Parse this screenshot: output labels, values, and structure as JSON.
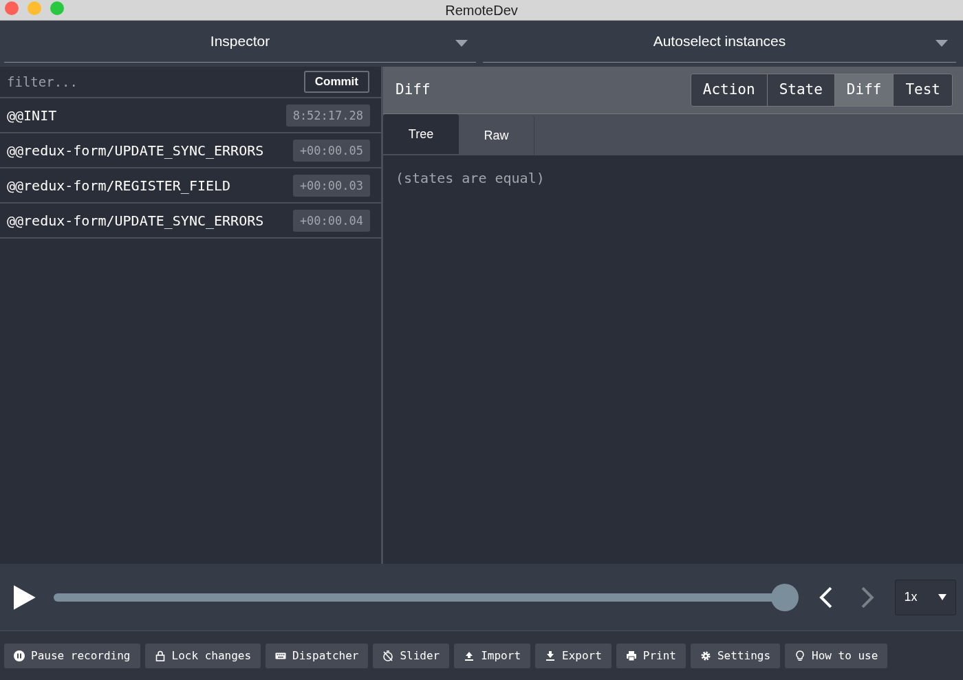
{
  "window": {
    "title": "RemoteDev"
  },
  "header": {
    "monitor": "Inspector",
    "instances": "Autoselect instances"
  },
  "filter": {
    "placeholder": "filter..."
  },
  "commit_button": "Commit",
  "actions": [
    {
      "name": "@@INIT",
      "time": "8:52:17.28",
      "selected": false
    },
    {
      "name": "@@redux-form/UPDATE_SYNC_ERRORS",
      "time": "+00:00.05",
      "selected": false
    },
    {
      "name": "@@redux-form/REGISTER_FIELD",
      "time": "+00:00.03",
      "selected": false
    },
    {
      "name": "@@redux-form/UPDATE_SYNC_ERRORS",
      "time": "+00:00.04",
      "selected": false
    }
  ],
  "detail": {
    "title": "Diff",
    "tabs": [
      {
        "label": "Action",
        "selected": false
      },
      {
        "label": "State",
        "selected": false
      },
      {
        "label": "Diff",
        "selected": true
      },
      {
        "label": "Test",
        "selected": false
      }
    ],
    "subtabs": [
      {
        "label": "Tree",
        "selected": true
      },
      {
        "label": "Raw",
        "selected": false
      }
    ],
    "message": "(states are equal)"
  },
  "player": {
    "level": 0.985,
    "previous_disabled": false,
    "next_disabled": true,
    "speed": "1x"
  },
  "footer_buttons": [
    "Pause recording",
    "Lock changes",
    "Dispatcher",
    "Slider",
    "Import",
    "Export",
    "Print",
    "Settings",
    "How to use"
  ]
}
